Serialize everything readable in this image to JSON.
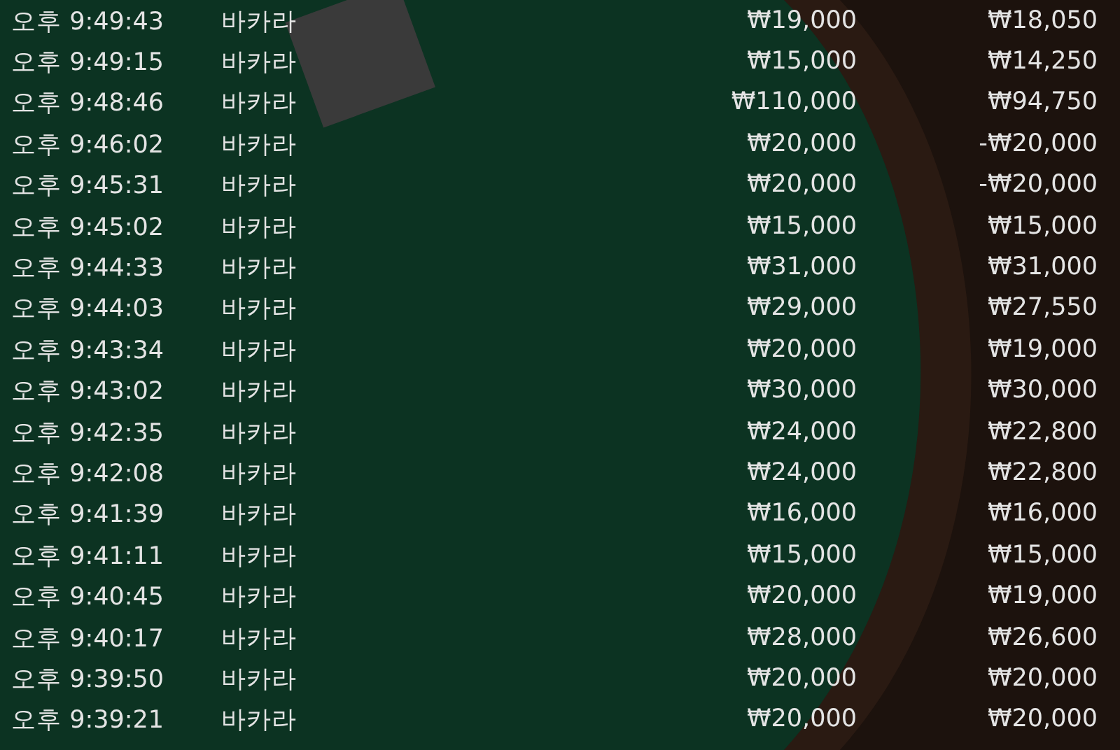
{
  "rows": [
    {
      "time": "오후 9:49:43",
      "game": "바카라",
      "bet": "₩19,000",
      "payout": "₩18,050"
    },
    {
      "time": "오후 9:49:15",
      "game": "바카라",
      "bet": "₩15,000",
      "payout": "₩14,250"
    },
    {
      "time": "오후 9:48:46",
      "game": "바카라",
      "bet": "₩110,000",
      "payout": "₩94,750"
    },
    {
      "time": "오후 9:46:02",
      "game": "바카라",
      "bet": "₩20,000",
      "payout": "-₩20,000"
    },
    {
      "time": "오후 9:45:31",
      "game": "바카라",
      "bet": "₩20,000",
      "payout": "-₩20,000"
    },
    {
      "time": "오후 9:45:02",
      "game": "바카라",
      "bet": "₩15,000",
      "payout": "₩15,000"
    },
    {
      "time": "오후 9:44:33",
      "game": "바카라",
      "bet": "₩31,000",
      "payout": "₩31,000"
    },
    {
      "time": "오후 9:44:03",
      "game": "바카라",
      "bet": "₩29,000",
      "payout": "₩27,550"
    },
    {
      "time": "오후 9:43:34",
      "game": "바카라",
      "bet": "₩20,000",
      "payout": "₩19,000"
    },
    {
      "time": "오후 9:43:02",
      "game": "바카라",
      "bet": "₩30,000",
      "payout": "₩30,000"
    },
    {
      "time": "오후 9:42:35",
      "game": "바카라",
      "bet": "₩24,000",
      "payout": "₩22,800"
    },
    {
      "time": "오후 9:42:08",
      "game": "바카라",
      "bet": "₩24,000",
      "payout": "₩22,800"
    },
    {
      "time": "오후 9:41:39",
      "game": "바카라",
      "bet": "₩16,000",
      "payout": "₩16,000"
    },
    {
      "time": "오후 9:41:11",
      "game": "바카라",
      "bet": "₩15,000",
      "payout": "₩15,000"
    },
    {
      "time": "오후 9:40:45",
      "game": "바카라",
      "bet": "₩20,000",
      "payout": "₩19,000"
    },
    {
      "time": "오후 9:40:17",
      "game": "바카라",
      "bet": "₩28,000",
      "payout": "₩26,600"
    },
    {
      "time": "오후 9:39:50",
      "game": "바카라",
      "bet": "₩20,000",
      "payout": "₩20,000"
    },
    {
      "time": "오후 9:39:21",
      "game": "바카라",
      "bet": "₩20,000",
      "payout": "₩20,000"
    }
  ]
}
